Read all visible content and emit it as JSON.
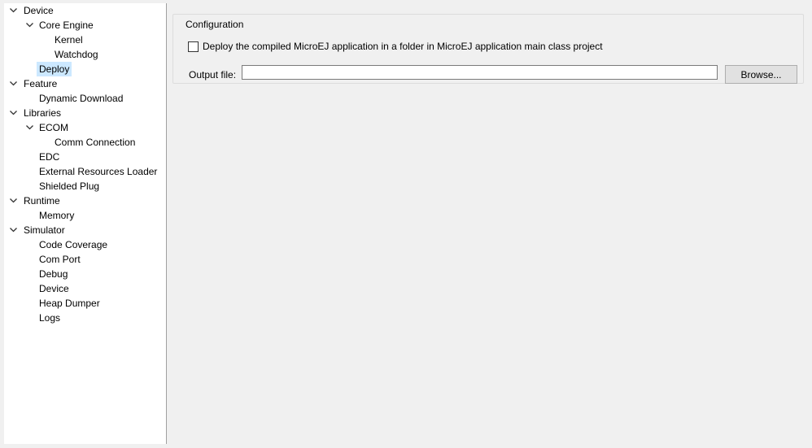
{
  "tree": {
    "items": [
      {
        "label": "Device",
        "level": 0,
        "expanded": true
      },
      {
        "label": "Core Engine",
        "level": 1,
        "expanded": true
      },
      {
        "label": "Kernel",
        "level": 2
      },
      {
        "label": "Watchdog",
        "level": 2
      },
      {
        "label": "Deploy",
        "level": 1,
        "selected": true
      },
      {
        "label": "Feature",
        "level": 0,
        "expanded": true
      },
      {
        "label": "Dynamic Download",
        "level": 1
      },
      {
        "label": "Libraries",
        "level": 0,
        "expanded": true
      },
      {
        "label": "ECOM",
        "level": 1,
        "expanded": true
      },
      {
        "label": "Comm Connection",
        "level": 2
      },
      {
        "label": "EDC",
        "level": 1
      },
      {
        "label": "External Resources Loader",
        "level": 1
      },
      {
        "label": "Shielded Plug",
        "level": 1
      },
      {
        "label": "Runtime",
        "level": 0,
        "expanded": true
      },
      {
        "label": "Memory",
        "level": 1
      },
      {
        "label": "Simulator",
        "level": 0,
        "expanded": true
      },
      {
        "label": "Code Coverage",
        "level": 1
      },
      {
        "label": "Com Port",
        "level": 1
      },
      {
        "label": "Debug",
        "level": 1
      },
      {
        "label": "Device",
        "level": 1
      },
      {
        "label": "Heap Dumper",
        "level": 1
      },
      {
        "label": "Logs",
        "level": 1
      }
    ]
  },
  "configuration": {
    "group_title": "Configuration",
    "deploy_checkbox_label": "Deploy the compiled MicroEJ application in a folder in MicroEJ application main class project",
    "deploy_checked": false,
    "output_label": "Output file:",
    "output_value": "",
    "browse_label": "Browse..."
  },
  "colors": {
    "selection": "#cce8ff",
    "background": "#f0f0f0"
  }
}
